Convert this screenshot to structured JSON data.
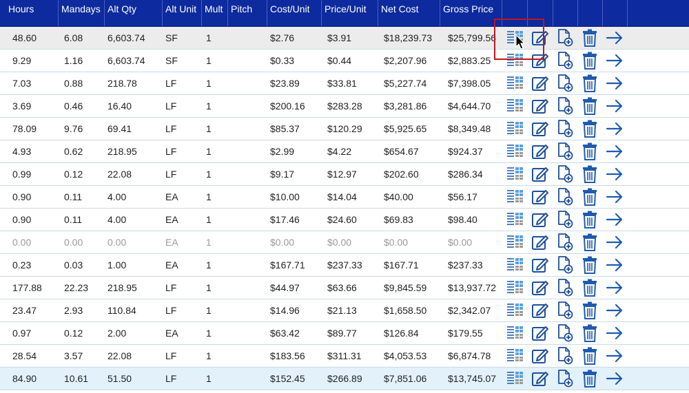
{
  "columns": [
    "Hours",
    "Mandays",
    "Alt Qty",
    "Alt Unit",
    "Mult",
    "Pitch",
    "Cost/Unit",
    "Price/Unit",
    "Net Cost",
    "Gross Price"
  ],
  "icons": {
    "detail": "grid-list-icon",
    "edit": "edit-icon",
    "add": "add-document-icon",
    "delete": "trash-icon",
    "go": "arrow-right-icon"
  },
  "colors": {
    "header_bg": "#0d2a9e",
    "icon_blue": "#1e4f9a",
    "highlight": "#c0151e",
    "row_border": "#c8dbe6"
  },
  "rows": [
    {
      "hours": "48.60",
      "mandays": "6.08",
      "alt_qty": "6,603.74",
      "alt_unit": "SF",
      "mult": "1",
      "pitch": "",
      "cost_unit": "$2.76",
      "price_unit": "$3.91",
      "net_cost": "$18,239.73",
      "gross_price": "$25,799.56"
    },
    {
      "hours": "9.29",
      "mandays": "1.16",
      "alt_qty": "6,603.74",
      "alt_unit": "SF",
      "mult": "1",
      "pitch": "",
      "cost_unit": "$0.33",
      "price_unit": "$0.44",
      "net_cost": "$2,207.96",
      "gross_price": "$2,883.25"
    },
    {
      "hours": "7.03",
      "mandays": "0.88",
      "alt_qty": "218.78",
      "alt_unit": "LF",
      "mult": "1",
      "pitch": "",
      "cost_unit": "$23.89",
      "price_unit": "$33.81",
      "net_cost": "$5,227.74",
      "gross_price": "$7,398.05"
    },
    {
      "hours": "3.69",
      "mandays": "0.46",
      "alt_qty": "16.40",
      "alt_unit": "LF",
      "mult": "1",
      "pitch": "",
      "cost_unit": "$200.16",
      "price_unit": "$283.28",
      "net_cost": "$3,281.86",
      "gross_price": "$4,644.70"
    },
    {
      "hours": "78.09",
      "mandays": "9.76",
      "alt_qty": "69.41",
      "alt_unit": "LF",
      "mult": "1",
      "pitch": "",
      "cost_unit": "$85.37",
      "price_unit": "$120.29",
      "net_cost": "$5,925.65",
      "gross_price": "$8,349.48"
    },
    {
      "hours": "4.93",
      "mandays": "0.62",
      "alt_qty": "218.95",
      "alt_unit": "LF",
      "mult": "1",
      "pitch": "",
      "cost_unit": "$2.99",
      "price_unit": "$4.22",
      "net_cost": "$654.67",
      "gross_price": "$924.37"
    },
    {
      "hours": "0.99",
      "mandays": "0.12",
      "alt_qty": "22.08",
      "alt_unit": "LF",
      "mult": "1",
      "pitch": "",
      "cost_unit": "$9.17",
      "price_unit": "$12.97",
      "net_cost": "$202.60",
      "gross_price": "$286.34"
    },
    {
      "hours": "0.90",
      "mandays": "0.11",
      "alt_qty": "4.00",
      "alt_unit": "EA",
      "mult": "1",
      "pitch": "",
      "cost_unit": "$10.00",
      "price_unit": "$14.04",
      "net_cost": "$40.00",
      "gross_price": "$56.17"
    },
    {
      "hours": "0.90",
      "mandays": "0.11",
      "alt_qty": "4.00",
      "alt_unit": "EA",
      "mult": "1",
      "pitch": "",
      "cost_unit": "$17.46",
      "price_unit": "$24.60",
      "net_cost": "$69.83",
      "gross_price": "$98.40"
    },
    {
      "hours": "0.00",
      "mandays": "0.00",
      "alt_qty": "0.00",
      "alt_unit": "EA",
      "mult": "1",
      "pitch": "",
      "cost_unit": "$0.00",
      "price_unit": "$0.00",
      "net_cost": "$0.00",
      "gross_price": "$0.00",
      "disabled": true
    },
    {
      "hours": "0.23",
      "mandays": "0.03",
      "alt_qty": "1.00",
      "alt_unit": "EA",
      "mult": "1",
      "pitch": "",
      "cost_unit": "$167.71",
      "price_unit": "$237.33",
      "net_cost": "$167.71",
      "gross_price": "$237.33"
    },
    {
      "hours": "177.88",
      "mandays": "22.23",
      "alt_qty": "218.95",
      "alt_unit": "LF",
      "mult": "1",
      "pitch": "",
      "cost_unit": "$44.97",
      "price_unit": "$63.66",
      "net_cost": "$9,845.59",
      "gross_price": "$13,937.72"
    },
    {
      "hours": "23.47",
      "mandays": "2.93",
      "alt_qty": "110.84",
      "alt_unit": "LF",
      "mult": "1",
      "pitch": "",
      "cost_unit": "$14.96",
      "price_unit": "$21.13",
      "net_cost": "$1,658.50",
      "gross_price": "$2,342.07"
    },
    {
      "hours": "0.97",
      "mandays": "0.12",
      "alt_qty": "2.00",
      "alt_unit": "EA",
      "mult": "1",
      "pitch": "",
      "cost_unit": "$63.42",
      "price_unit": "$89.77",
      "net_cost": "$126.84",
      "gross_price": "$179.55"
    },
    {
      "hours": "28.54",
      "mandays": "3.57",
      "alt_qty": "22.08",
      "alt_unit": "LF",
      "mult": "1",
      "pitch": "",
      "cost_unit": "$183.56",
      "price_unit": "$311.31",
      "net_cost": "$4,053.53",
      "gross_price": "$6,874.78"
    },
    {
      "hours": "84.90",
      "mandays": "10.61",
      "alt_qty": "51.50",
      "alt_unit": "LF",
      "mult": "1",
      "pitch": "",
      "cost_unit": "$152.45",
      "price_unit": "$266.89",
      "net_cost": "$7,851.06",
      "gross_price": "$13,745.07",
      "selected": true
    }
  ]
}
